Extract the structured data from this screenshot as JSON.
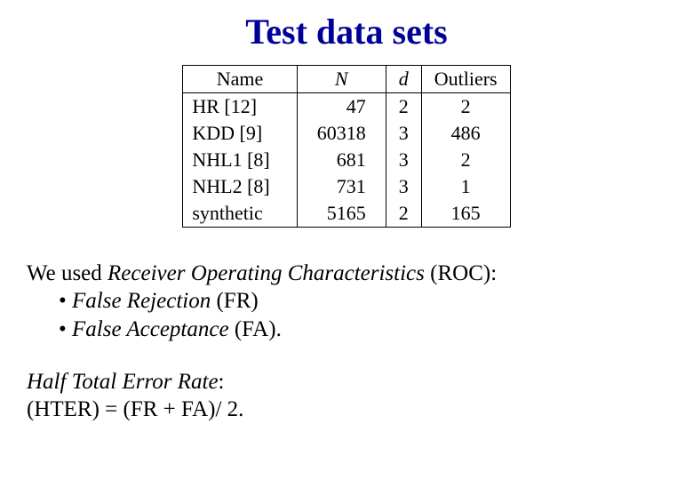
{
  "title": "Test data sets",
  "table": {
    "headers": {
      "name": "Name",
      "N": "N",
      "d": "d",
      "out": "Outliers"
    },
    "rows": [
      {
        "name": "HR [12]",
        "N": "47",
        "d": "2",
        "out": "2"
      },
      {
        "name": "KDD [9]",
        "N": "60318",
        "d": "3",
        "out": "486"
      },
      {
        "name": "NHL1 [8]",
        "N": "681",
        "d": "3",
        "out": "2"
      },
      {
        "name": "NHL2 [8]",
        "N": "731",
        "d": "3",
        "out": "1"
      },
      {
        "name": "synthetic",
        "N": "5165",
        "d": "2",
        "out": "165"
      }
    ]
  },
  "para1": {
    "line1a": "We used ",
    "line1b": "Receiver Operating Characteristics",
    "line1c": " (ROC):",
    "bullet1a": "• ",
    "bullet1b": "False Rejection",
    "bullet1c": " (FR)",
    "bullet2a": "• ",
    "bullet2b": "False Acceptance",
    "bullet2c": " (FA)."
  },
  "para2": {
    "line1": "Half Total Error Rate",
    "line1suffix": ":",
    "line2": "(HTER) = (FR + FA)/ 2."
  }
}
